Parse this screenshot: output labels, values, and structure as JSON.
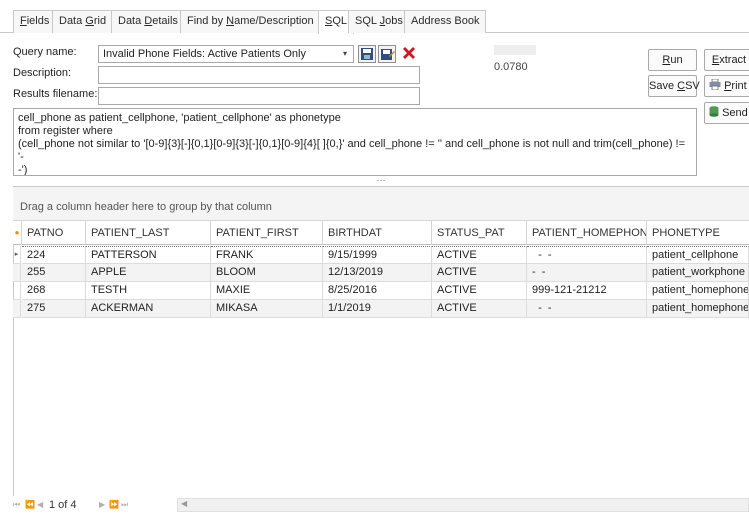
{
  "tabs": [
    {
      "pre": "",
      "u": "F",
      "post": "ields"
    },
    {
      "pre": "Data ",
      "u": "G",
      "post": "rid"
    },
    {
      "pre": "Data ",
      "u": "D",
      "post": "etails"
    },
    {
      "pre": "Find by ",
      "u": "N",
      "post": "ame/Description"
    },
    {
      "pre": "",
      "u": "S",
      "post": "QL"
    },
    {
      "pre": "SQL ",
      "u": "J",
      "post": "obs"
    },
    {
      "pre": "Address Book",
      "u": "",
      "post": ""
    }
  ],
  "form": {
    "query_name_label": "Query name:",
    "query_name_value": "Invalid Phone Fields: Active Patients Only",
    "description_label": "Description:",
    "description_value": "",
    "results_filename_label": "Results filename:",
    "results_filename_value": "",
    "timing_value": "0.0780"
  },
  "buttons": {
    "run": {
      "pre": "",
      "u": "R",
      "post": "un"
    },
    "extract": {
      "pre": "",
      "u": "E",
      "post": "xtract"
    },
    "save_csv": {
      "pre": "Save ",
      "u": "C",
      "post": "SV"
    },
    "print": {
      "pre": "",
      "u": "P",
      "post": "rint"
    },
    "send": {
      "pre": "Send",
      "u": "",
      "post": ""
    }
  },
  "sql_text": "cell_phone as patient_cellphone, 'patient_cellphone' as phonetype\nfrom register where\n(cell_phone not similar to '[0-9]{3}[-]{0,1}[0-9]{3}[-]{0,1}[0-9]{4}[ ]{0,}' and cell_phone != '' and cell_phone is not null and trim(cell_phone) != '-\n-')",
  "grid": {
    "group_prompt": "Drag a column header here to group by that column",
    "columns": [
      "PATNO",
      "PATIENT_LAST",
      "PATIENT_FIRST",
      "BIRTHDAT",
      "STATUS_PAT",
      "PATIENT_HOMEPHONE",
      "PHONETYPE"
    ],
    "rows": [
      [
        "224",
        "PATTERSON",
        "FRANK",
        "9/15/1999",
        "ACTIVE",
        "  -  -",
        "patient_cellphone"
      ],
      [
        "255",
        "APPLE",
        "BLOOM",
        "12/13/2019",
        "ACTIVE",
        "-  -",
        "patient_workphone"
      ],
      [
        "268",
        "TESTH",
        "MAXIE",
        "8/25/2016",
        "ACTIVE",
        "999-121-21212",
        "patient_homephone"
      ],
      [
        "275",
        "ACKERMAN",
        "MIKASA",
        "1/1/2019",
        "ACTIVE",
        "  -  -",
        "patient_homephone"
      ]
    ]
  },
  "nav": {
    "position": "1 of 4"
  },
  "colors": {
    "delete_icon": "#d0161e",
    "save_icon": "#2f4f7f",
    "header_marker": "#f08a00"
  },
  "icons": [
    "save-icon",
    "save-as-icon",
    "delete-icon",
    "printer-icon",
    "database-icon",
    "chevron-down-icon"
  ]
}
